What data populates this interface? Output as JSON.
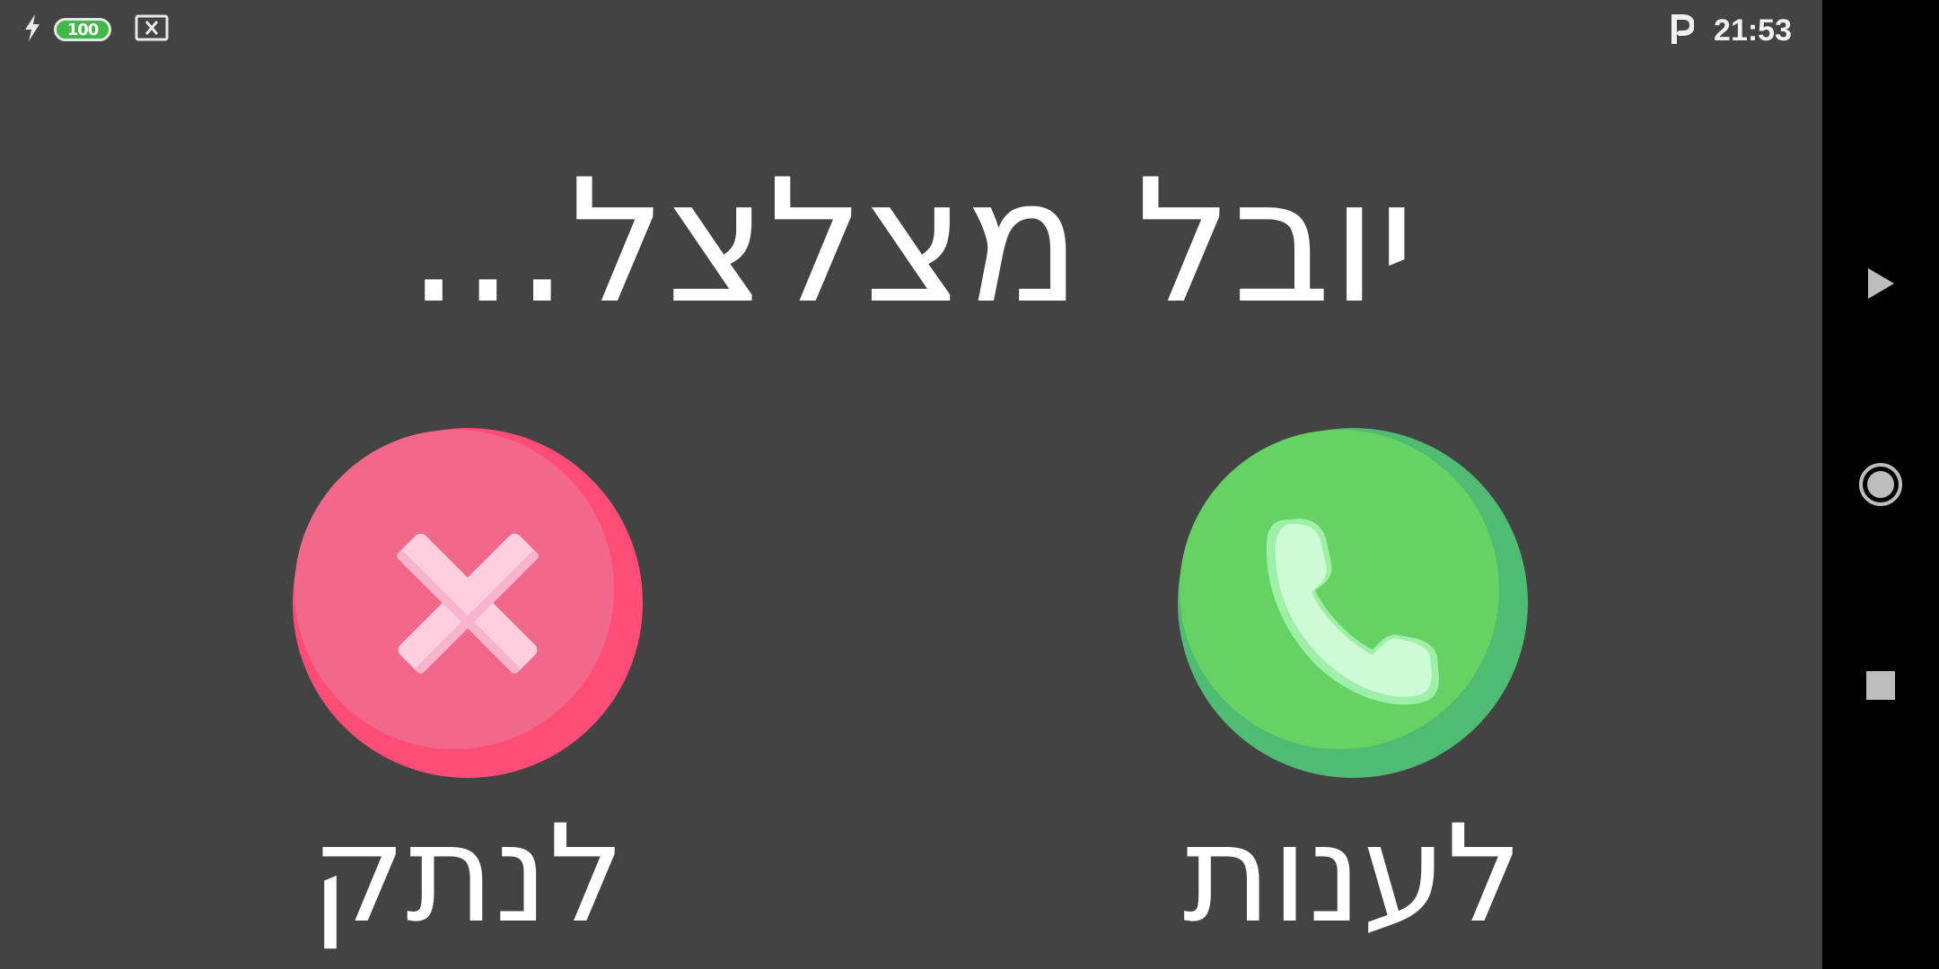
{
  "status_bar": {
    "battery_level": "100",
    "time": "21:53",
    "icons": [
      "charging-bolt-icon",
      "battery-icon",
      "no-sim-icon",
      "parking-app-icon"
    ],
    "colors": {
      "battery_fill": "#43b84a"
    }
  },
  "call": {
    "title": "יובל מצלצל...",
    "decline_label": "לנתק",
    "answer_label": "לענות",
    "colors": {
      "background": "#434343",
      "decline": "#f2688a",
      "decline_shadow": "#ff4d78",
      "answer": "#66d264",
      "answer_shadow": "#4fbb73"
    }
  },
  "navbar": {
    "icons": [
      "back-triangle-icon",
      "home-circle-icon",
      "recents-square-icon"
    ]
  }
}
